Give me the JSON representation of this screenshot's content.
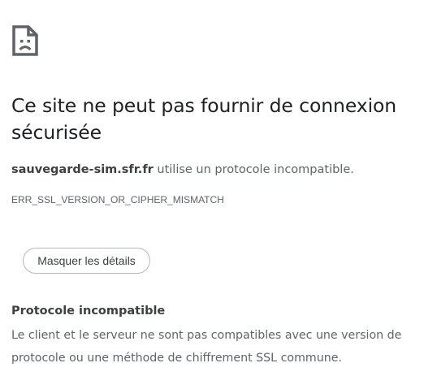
{
  "error_page": {
    "icon": "sad-document-icon",
    "title": "Ce site ne peut pas fournir de connexion sécurisée",
    "summary": {
      "host": "sauvegarde-sim.sfr.fr",
      "text": " utilise un protocole incompatible."
    },
    "error_code": "ERR_SSL_VERSION_OR_CIPHER_MISMATCH",
    "details_button_label": "Masquer les détails",
    "details": {
      "heading": "Protocole incompatible",
      "text": "Le client et le serveur ne sont pas compatibles avec une version de protocole ou une méthode de chiffrement SSL commune."
    }
  },
  "colors": {
    "text_primary": "#202124",
    "text_secondary": "#5f6368",
    "button_border": "#b4b7bb"
  }
}
